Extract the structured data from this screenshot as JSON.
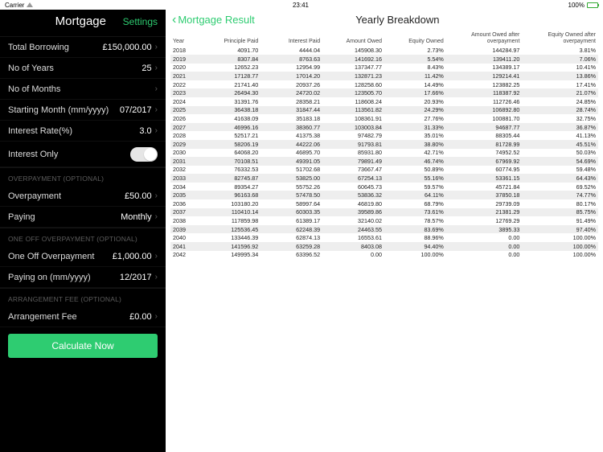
{
  "status": {
    "carrier": "Carrier",
    "wifi": true,
    "time": "23:41",
    "battery_pct": "100%"
  },
  "sidebar": {
    "title": "Mortgage",
    "settings": "Settings",
    "basic": {
      "borrowing": {
        "label": "Total Borrowing",
        "value": "£150,000.00"
      },
      "years": {
        "label": "No of Years",
        "value": "25"
      },
      "months": {
        "label": "No of Months",
        "value": ""
      },
      "start": {
        "label": "Starting Month (mm/yyyy)",
        "value": "07/2017"
      },
      "rate": {
        "label": "Interest Rate(%)",
        "value": "3.0"
      },
      "io": {
        "label": "Interest Only",
        "toggle": false
      }
    },
    "overpayment": {
      "section": "OVERPAYMENT (OPTIONAL)",
      "amount": {
        "label": "Overpayment",
        "value": "£50.00"
      },
      "paying": {
        "label": "Paying",
        "value": "Monthly"
      }
    },
    "oneoff": {
      "section": "ONE OFF OVERPAYMENT (OPTIONAL)",
      "amount": {
        "label": "One Off Overpayment",
        "value": "£1,000.00"
      },
      "paying": {
        "label": "Paying on (mm/yyyy)",
        "value": "12/2017"
      }
    },
    "arrfee": {
      "section": "ARRANGEMENT FEE (OPTIONAL)",
      "amount": {
        "label": "Arrangement Fee",
        "value": "£0.00"
      }
    },
    "calc": "Calculate Now"
  },
  "content": {
    "back": "Mortgage Result",
    "title": "Yearly Breakdown",
    "headers": [
      "Year",
      "Principle Paid",
      "Interest Paid",
      "Amount Owed",
      "Equity Owned",
      "Amount Owed after overpayment",
      "Equity Owned after overpayment"
    ]
  },
  "chart_data": {
    "type": "table",
    "title": "Yearly Breakdown",
    "columns": [
      "Year",
      "Principle Paid",
      "Interest Paid",
      "Amount Owed",
      "Equity Owned",
      "Amount Owed after overpayment",
      "Equity Owned after overpayment"
    ],
    "rows": [
      [
        "2018",
        "4091.70",
        "4444.04",
        "145908.30",
        "2.73%",
        "144284.97",
        "3.81%"
      ],
      [
        "2019",
        "8307.84",
        "8763.63",
        "141692.16",
        "5.54%",
        "139411.20",
        "7.06%"
      ],
      [
        "2020",
        "12652.23",
        "12954.99",
        "137347.77",
        "8.43%",
        "134389.17",
        "10.41%"
      ],
      [
        "2021",
        "17128.77",
        "17014.20",
        "132871.23",
        "11.42%",
        "129214.41",
        "13.86%"
      ],
      [
        "2022",
        "21741.40",
        "20937.26",
        "128258.60",
        "14.49%",
        "123882.25",
        "17.41%"
      ],
      [
        "2023",
        "26494.30",
        "24720.02",
        "123505.70",
        "17.66%",
        "118387.92",
        "21.07%"
      ],
      [
        "2024",
        "31391.76",
        "28358.21",
        "118608.24",
        "20.93%",
        "112726.46",
        "24.85%"
      ],
      [
        "2025",
        "36438.18",
        "31847.44",
        "113561.82",
        "24.29%",
        "106892.80",
        "28.74%"
      ],
      [
        "2026",
        "41638.09",
        "35183.18",
        "108361.91",
        "27.76%",
        "100881.70",
        "32.75%"
      ],
      [
        "2027",
        "46996.16",
        "38360.77",
        "103003.84",
        "31.33%",
        "94687.77",
        "36.87%"
      ],
      [
        "2028",
        "52517.21",
        "41375.38",
        "97482.79",
        "35.01%",
        "88305.44",
        "41.13%"
      ],
      [
        "2029",
        "58206.19",
        "44222.06",
        "91793.81",
        "38.80%",
        "81728.99",
        "45.51%"
      ],
      [
        "2030",
        "64068.20",
        "46895.70",
        "85931.80",
        "42.71%",
        "74952.52",
        "50.03%"
      ],
      [
        "2031",
        "70108.51",
        "49391.05",
        "79891.49",
        "46.74%",
        "67969.92",
        "54.69%"
      ],
      [
        "2032",
        "76332.53",
        "51702.68",
        "73667.47",
        "50.89%",
        "60774.95",
        "59.48%"
      ],
      [
        "2033",
        "82745.87",
        "53825.00",
        "67254.13",
        "55.16%",
        "53361.15",
        "64.43%"
      ],
      [
        "2034",
        "89354.27",
        "55752.26",
        "60645.73",
        "59.57%",
        "45721.84",
        "69.52%"
      ],
      [
        "2035",
        "96163.68",
        "57478.50",
        "53836.32",
        "64.11%",
        "37850.18",
        "74.77%"
      ],
      [
        "2036",
        "103180.20",
        "58997.64",
        "46819.80",
        "68.79%",
        "29739.09",
        "80.17%"
      ],
      [
        "2037",
        "110410.14",
        "60303.35",
        "39589.86",
        "73.61%",
        "21381.29",
        "85.75%"
      ],
      [
        "2038",
        "117859.98",
        "61389.17",
        "32140.02",
        "78.57%",
        "12769.29",
        "91.49%"
      ],
      [
        "2039",
        "125536.45",
        "62248.39",
        "24463.55",
        "83.69%",
        "3895.33",
        "97.40%"
      ],
      [
        "2040",
        "133446.39",
        "62874.13",
        "16553.61",
        "88.96%",
        "0.00",
        "100.00%"
      ],
      [
        "2041",
        "141596.92",
        "63259.28",
        "8403.08",
        "94.40%",
        "0.00",
        "100.00%"
      ],
      [
        "2042",
        "149995.34",
        "63396.52",
        "0.00",
        "100.00%",
        "0.00",
        "100.00%"
      ]
    ]
  }
}
